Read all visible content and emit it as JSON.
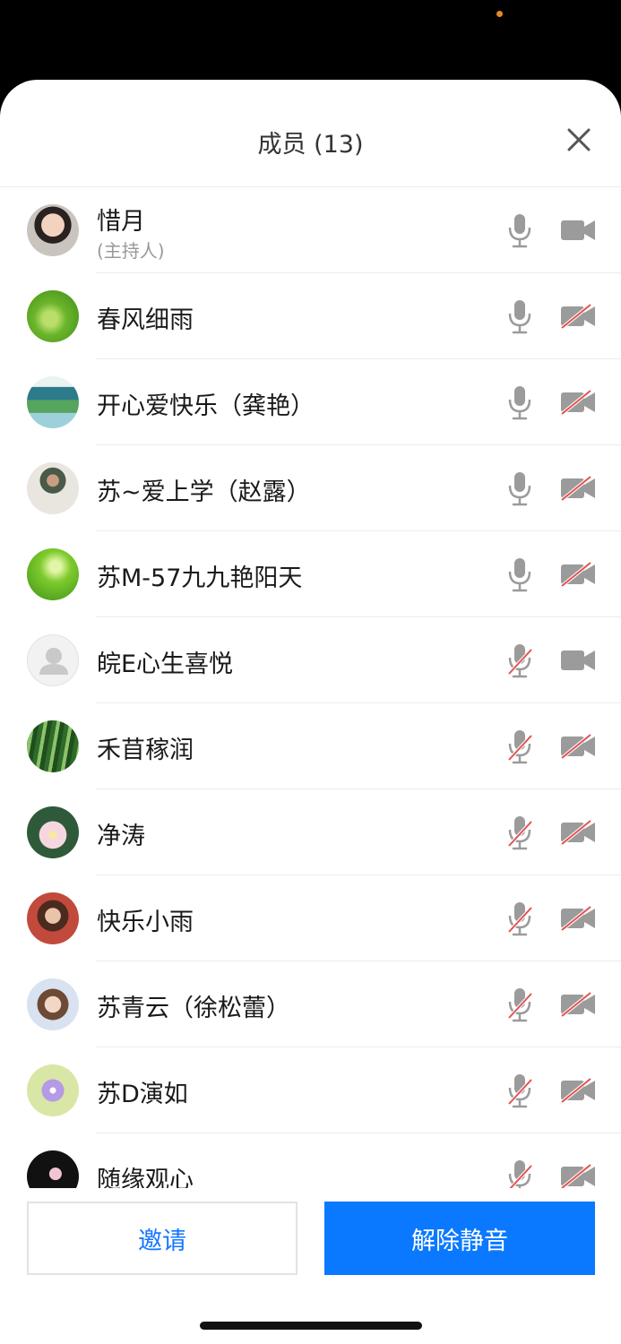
{
  "panel": {
    "title": "成员 (13)",
    "close_icon": "close-icon"
  },
  "members": [
    {
      "name": "惜月",
      "role": "(主持人)",
      "avatar": "photo-woman-avatar",
      "mic": "on",
      "camera": "on"
    },
    {
      "name": "春风细雨",
      "avatar": "green-leaf-avatar",
      "mic": "on",
      "camera": "off"
    },
    {
      "name": "开心爱快乐（龚艳）",
      "avatar": "landscape-avatar",
      "mic": "on",
      "camera": "off"
    },
    {
      "name": "苏~爱上学（赵露）",
      "avatar": "person-photo-avatar",
      "mic": "on",
      "camera": "off"
    },
    {
      "name": "苏M-57九九艳阳天",
      "avatar": "grass-dew-avatar",
      "mic": "on",
      "camera": "off"
    },
    {
      "name": "皖E心生喜悦",
      "avatar": "default-user-avatar",
      "mic": "off",
      "camera": "on"
    },
    {
      "name": "禾苜稼润",
      "avatar": "forest-avatar",
      "mic": "off",
      "camera": "off"
    },
    {
      "name": "净涛",
      "avatar": "lotus-avatar",
      "mic": "off",
      "camera": "off"
    },
    {
      "name": "快乐小雨",
      "avatar": "woman-portrait-avatar",
      "mic": "off",
      "camera": "off"
    },
    {
      "name": "苏青云（徐松蕾）",
      "avatar": "girl-portrait-avatar",
      "mic": "off",
      "camera": "off"
    },
    {
      "name": "苏D演如",
      "avatar": "purple-flower-avatar",
      "mic": "off",
      "camera": "off"
    },
    {
      "name": "随缘观心",
      "avatar": "lotus-dark-avatar",
      "mic": "off",
      "camera": "off"
    }
  ],
  "footer": {
    "invite_label": "邀请",
    "unmute_label": "解除静音"
  },
  "colors": {
    "accent": "#0a79ff",
    "icon_gray": "#9b9b9b",
    "muted_slash": "#e05252"
  }
}
